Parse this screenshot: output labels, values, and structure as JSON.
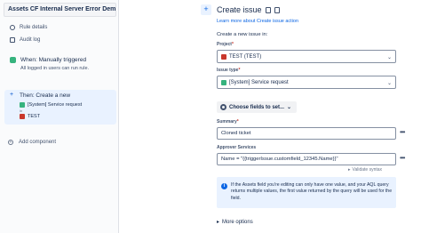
{
  "left": {
    "header": "Assets CF Internal Server Error Demo",
    "nav": [
      {
        "label": "Rule details",
        "icon": "gear-icon"
      },
      {
        "label": "Audit log",
        "icon": "list-icon"
      }
    ],
    "trigger": {
      "title": "When: Manually triggered",
      "subtitle": "All logged in users can run rule."
    },
    "action": {
      "title": "Then: Create a new",
      "issue_type": "[System] Service request",
      "in_label": "in",
      "project": "TEST"
    },
    "add_component": "Add component"
  },
  "right": {
    "title": "Create issue",
    "learn_more": "Learn more about Create issue action",
    "create_in": "Create a new issue in:",
    "project_label": "Project",
    "project_value": "TEST (TEST)",
    "issue_type_label": "Issue type",
    "issue_type_value": "[System] Service request",
    "choose_fields": "Choose fields to set...",
    "summary_label": "Summary",
    "summary_value": "Cloned ticket",
    "approver_label": "Approver Services",
    "approver_value": "Name = \"{{triggerIssue.customfield_12345.Name}}\"",
    "validate": "Validate syntax",
    "info": "If the Assets field you're editing can only have one value, and your AQL query returns multiple values, the first value returned by the query will be used for the field.",
    "more_options": "More options"
  },
  "colors": {
    "accent": "#0c66e4",
    "trigger": "#36b37e",
    "project": "#c9372c",
    "card_bg": "#e9f2ff"
  }
}
